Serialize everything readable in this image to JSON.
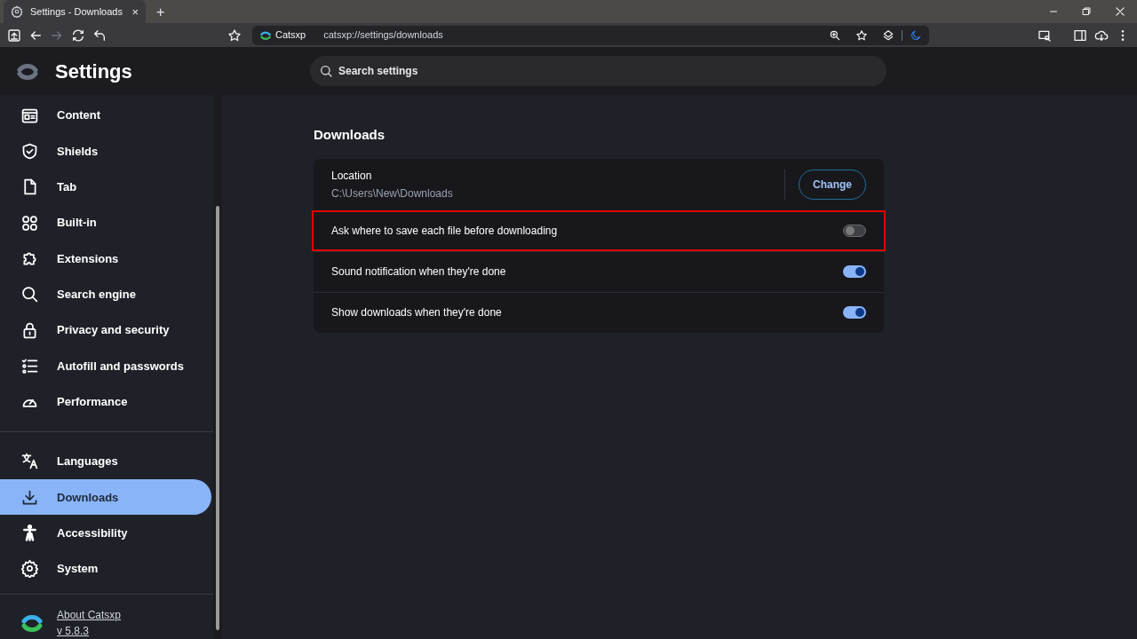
{
  "browser_tab": {
    "title": "Settings - Downloads",
    "close": "×",
    "new_tab": "+"
  },
  "address_bar": {
    "site": "Catsxp",
    "url": "catsxp://settings/downloads"
  },
  "header": {
    "title": "Settings",
    "search": {
      "placeholder": "Search settings"
    }
  },
  "sidebar": {
    "groups": [
      {
        "items": [
          {
            "label": "Content",
            "selected": false
          },
          {
            "label": "Shields",
            "selected": false
          },
          {
            "label": "Tab",
            "selected": false
          },
          {
            "label": "Built-in",
            "selected": false
          },
          {
            "label": "Extensions",
            "selected": false
          },
          {
            "label": "Search engine",
            "selected": false
          },
          {
            "label": "Privacy and security",
            "selected": false
          },
          {
            "label": "Autofill and passwords",
            "selected": false
          },
          {
            "label": "Performance",
            "selected": false
          }
        ]
      },
      {
        "items": [
          {
            "label": "Languages",
            "selected": false
          },
          {
            "label": "Downloads",
            "selected": true
          },
          {
            "label": "Accessibility",
            "selected": false
          },
          {
            "label": "System",
            "selected": false
          }
        ]
      }
    ],
    "about": {
      "link": "About Catsxp",
      "version": "v 5.8.3"
    }
  },
  "section": {
    "title": "Downloads",
    "location": {
      "label": "Location",
      "value": "C:\\Users\\New\\Downloads",
      "button": "Change"
    },
    "toggles": [
      {
        "label": "Ask where to save each file before downloading",
        "on": false,
        "highlighted": true
      },
      {
        "label": "Sound notification when they're done",
        "on": true,
        "highlighted": false
      },
      {
        "label": "Show downloads when they're done",
        "on": true,
        "highlighted": false
      }
    ]
  }
}
